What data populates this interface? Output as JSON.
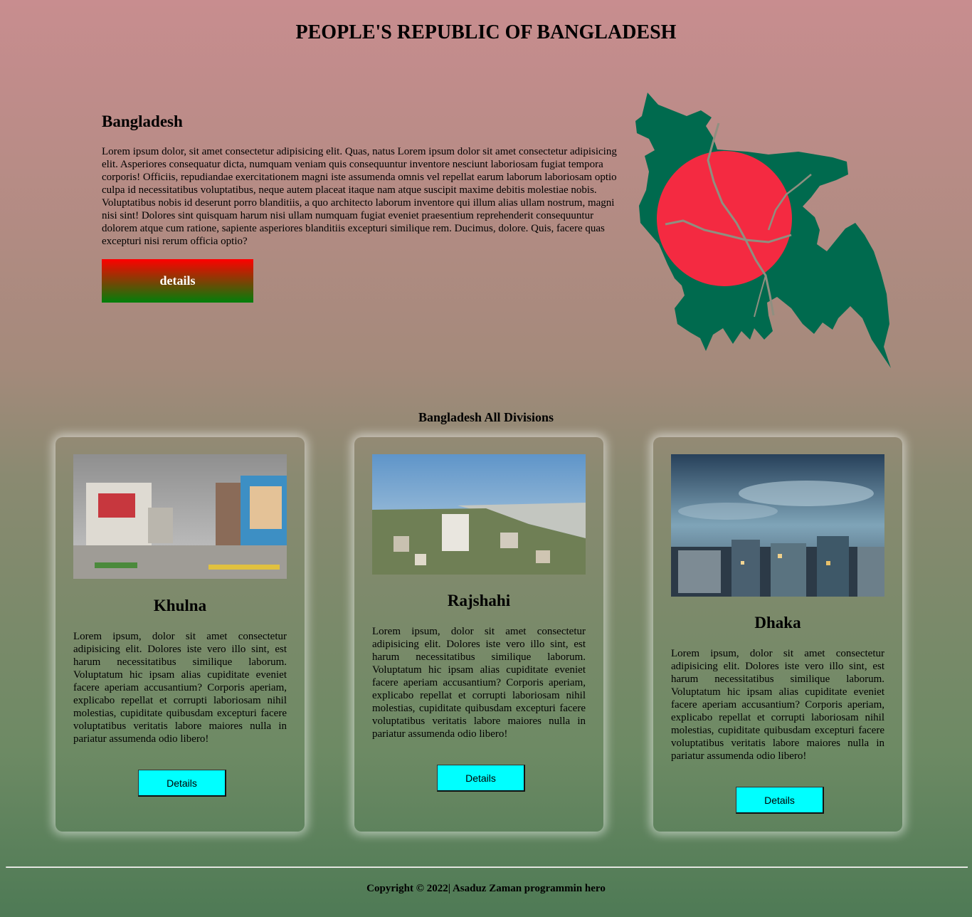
{
  "page": {
    "title": "PEOPLE'S REPUBLIC OF BANGLADESH"
  },
  "hero": {
    "heading": "Bangladesh",
    "body": "Lorem ipsum dolor, sit amet consectetur adipisicing elit. Quas, natus Lorem ipsum dolor sit amet consectetur adipisicing elit. Asperiores consequatur dicta, numquam veniam quis consequuntur inventore nesciunt laboriosam fugiat tempora corporis! Officiis, repudiandae exercitationem magni iste assumenda omnis vel repellat earum laborum laboriosam optio culpa id necessitatibus voluptatibus, neque autem placeat itaque nam atque suscipit maxime debitis molestiae nobis. Voluptatibus nobis id deserunt porro blanditiis, a quo architecto laborum inventore qui illum alias ullam nostrum, magni nisi sint! Dolores sint quisquam harum nisi ullam numquam fugiat eveniet praesentium reprehenderit consequuntur dolorem atque cum ratione, sapiente asperiores blanditiis excepturi similique rem. Ducimus, dolore. Quis, facere quas excepturi nisi rerum officia optio?",
    "button_label": "details"
  },
  "divisions": {
    "heading": "Bangladesh All Divisions",
    "cards": [
      {
        "title": "Khulna",
        "body": "Lorem ipsum, dolor sit amet consectetur adipisicing elit. Dolores iste vero illo sint, est harum necessitatibus similique laborum. Voluptatum hic ipsam alias cupiditate eveniet facere aperiam accusantium? Corporis aperiam, explicabo repellat et corrupti laboriosam nihil molestias, cupiditate quibusdam excepturi facere voluptatibus veritatis labore maiores nulla in pariatur assumenda odio libero!",
        "button_label": "Details"
      },
      {
        "title": "Rajshahi",
        "body": "Lorem ipsum, dolor sit amet consectetur adipisicing elit. Dolores iste vero illo sint, est harum necessitatibus similique laborum. Voluptatum hic ipsam alias cupiditate eveniet facere aperiam accusantium? Corporis aperiam, explicabo repellat et corrupti laboriosam nihil molestias, cupiditate quibusdam excepturi facere voluptatibus veritatis labore maiores nulla in pariatur assumenda odio libero!",
        "button_label": "Details"
      },
      {
        "title": "Dhaka",
        "body": "Lorem ipsum, dolor sit amet consectetur adipisicing elit. Dolores iste vero illo sint, est harum necessitatibus similique laborum. Voluptatum hic ipsam alias cupiditate eveniet facere aperiam accusantium? Corporis aperiam, explicabo repellat et corrupti laboriosam nihil molestias, cupiditate quibusdam excepturi facere voluptatibus veritatis labore maiores nulla in pariatur assumenda odio libero!",
        "button_label": "Details"
      }
    ]
  },
  "footer": {
    "copyright": "Copyright © 2022| Asaduz Zaman programmin hero"
  },
  "colors": {
    "flag_green": "#006a4e",
    "flag_red": "#f42a41",
    "card_button": "#00ffff",
    "hero_button_top": "#ff0000",
    "hero_button_bottom": "#00800a"
  }
}
